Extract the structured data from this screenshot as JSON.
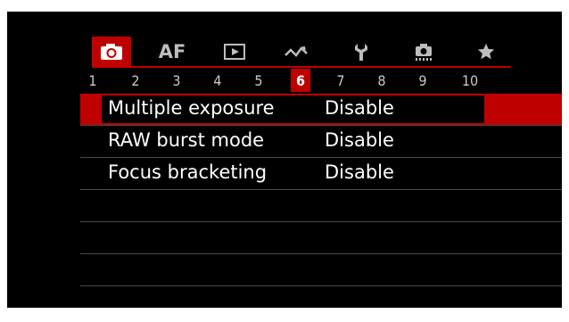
{
  "tabs": [
    {
      "name": "camera-icon",
      "label": "",
      "active": true
    },
    {
      "name": "af-tab",
      "label": "AF",
      "active": false
    },
    {
      "name": "playback-icon",
      "label": "",
      "active": false
    },
    {
      "name": "wireless-icon",
      "label": "",
      "active": false
    },
    {
      "name": "wrench-icon",
      "label": "",
      "active": false
    },
    {
      "name": "custom-functions-icon",
      "label": "",
      "active": false
    },
    {
      "name": "star-icon",
      "label": "",
      "active": false
    }
  ],
  "pages": [
    "1",
    "2",
    "3",
    "4",
    "5",
    "6",
    "7",
    "8",
    "9",
    "10"
  ],
  "active_page": "6",
  "menu": {
    "items": [
      {
        "label": "Multiple exposure",
        "value": "Disable",
        "selected": true
      },
      {
        "label": "RAW burst mode",
        "value": "Disable",
        "selected": false
      },
      {
        "label": "Focus bracketing",
        "value": "Disable",
        "selected": false
      }
    ]
  },
  "colors": {
    "accent": "#bf0000",
    "background": "#000000",
    "text": "#ffffff"
  }
}
